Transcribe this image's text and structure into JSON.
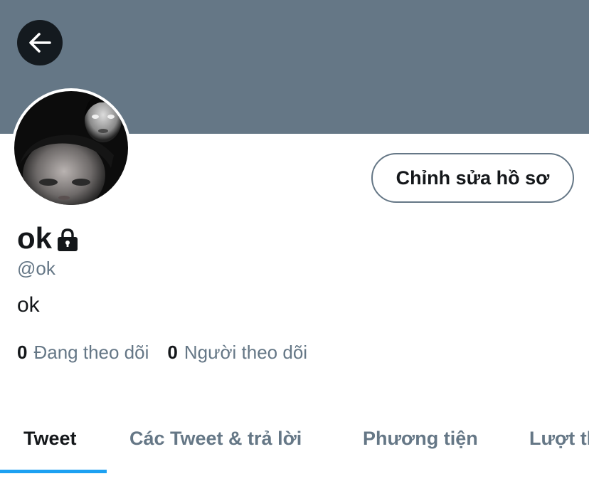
{
  "header": {
    "banner_color": "#657786",
    "back_icon": "arrow-left-icon"
  },
  "profile": {
    "display_name": "ok",
    "lock_icon": "lock-icon",
    "handle": "@ok",
    "bio": "ok",
    "edit_button_label": "Chỉnh sửa hồ sơ"
  },
  "stats": {
    "following_count": "0",
    "following_label": "Đang theo dõi",
    "followers_count": "0",
    "followers_label": "Người theo dõi"
  },
  "tabs": [
    {
      "label": "Tweet",
      "active": true
    },
    {
      "label": "Các Tweet & trả lời",
      "active": false
    },
    {
      "label": "Phương tiện",
      "active": false
    },
    {
      "label": "Lượt thích",
      "active": false
    }
  ],
  "colors": {
    "accent": "#1da1f2",
    "secondary_text": "#657786",
    "primary_text": "#14171a"
  }
}
